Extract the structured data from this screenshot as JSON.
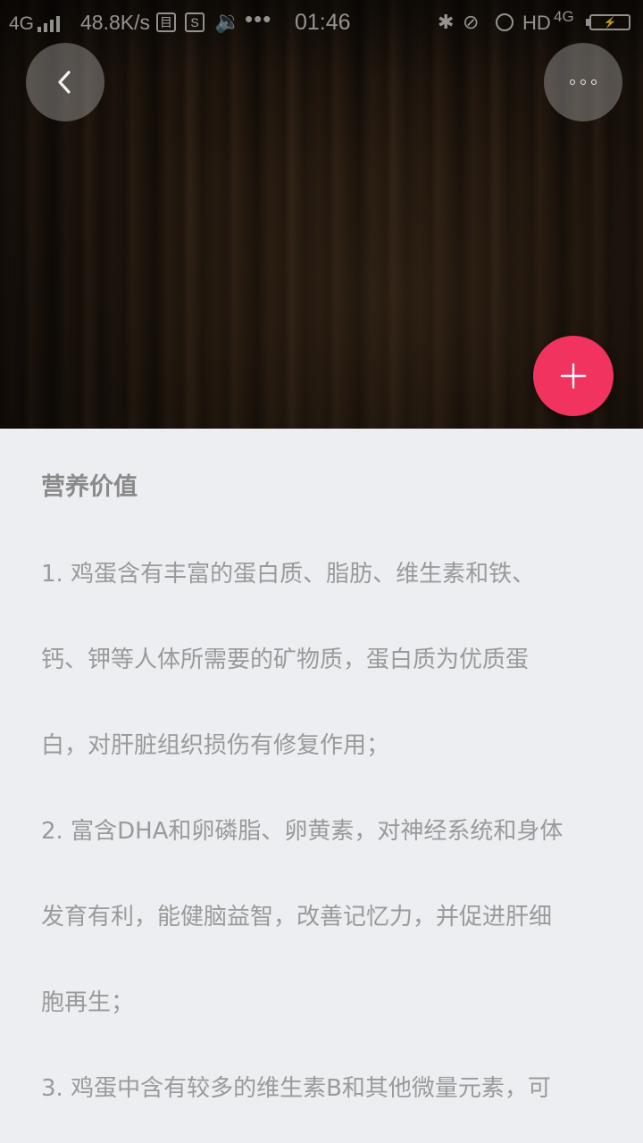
{
  "status_bar": {
    "network": "4G",
    "speed": "48.8K/s",
    "icon_a": "目",
    "icon_b": "S",
    "speaker_icon": "🔉",
    "more_dots": "•••",
    "time": "01:46",
    "bluetooth_icon": "✱",
    "mute_icon": "⊘",
    "hd": "HD",
    "network2": "4G",
    "battery_icon": "⚡"
  },
  "header": {
    "back_icon": "chevron-left-icon",
    "more_icon": "more-dots-icon",
    "fab_icon": "plus-icon"
  },
  "content": {
    "title": "营养价值",
    "lines": [
      "1. 鸡蛋含有丰富的蛋白质、脂肪、维生素和铁、",
      "钙、钾等人体所需要的矿物质，蛋白质为优质蛋",
      "白，对肝脏组织损伤有修复作用；",
      "2. 富含DHA和卵磷脂、卵黄素，对神经系统和身体",
      "发育有利，能健脑益智，改善记忆力，并促进肝细",
      "胞再生；",
      "3. 鸡蛋中含有较多的维生素B和其他微量元素，可"
    ]
  },
  "colors": {
    "fab": "#f0335f",
    "background": "#eceef1",
    "text": "#9a9a9a",
    "title": "#8a8a8a"
  }
}
